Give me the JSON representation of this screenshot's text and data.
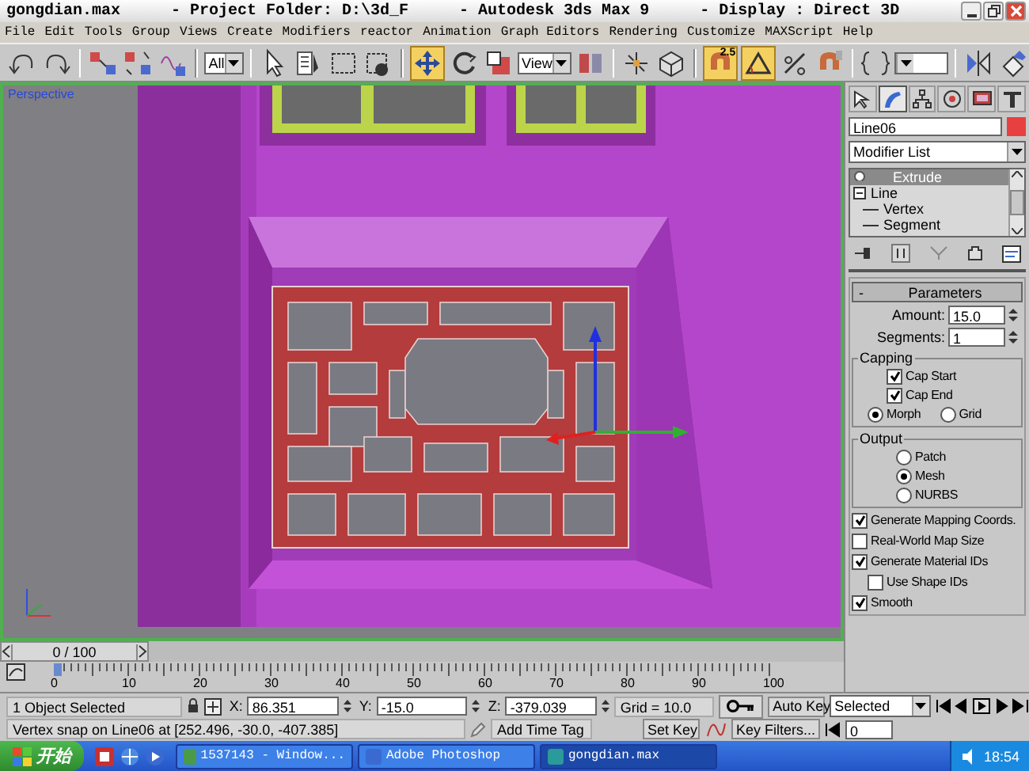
{
  "window": {
    "title_parts": [
      "gongdian.max",
      "- Project Folder: D:\\3d_F",
      "- Autodesk 3ds Max 9",
      "- Display : Direct 3D"
    ]
  },
  "menu": [
    "File",
    "Edit",
    "Tools",
    "Group",
    "Views",
    "Create",
    "Modifiers",
    "reactor",
    "Animation",
    "Graph Editors",
    "Rendering",
    "Customize",
    "MAXScript",
    "Help"
  ],
  "toolbar": [
    {
      "kind": "tool",
      "selected": false
    },
    {
      "kind": "tool",
      "selected": false
    },
    {
      "kind": "separator"
    },
    {
      "kind": "tool",
      "selected": false
    },
    {
      "kind": "tool",
      "selected": false
    },
    {
      "kind": "tool",
      "selected": false
    },
    {
      "kind": "separator"
    },
    {
      "kind": "dropdown",
      "value": "All"
    },
    {
      "kind": "separator"
    },
    {
      "kind": "tool",
      "selected": false
    },
    {
      "kind": "tool",
      "selected": false
    },
    {
      "kind": "tool",
      "selected": false
    },
    {
      "kind": "tool",
      "selected": false
    },
    {
      "kind": "separator"
    },
    {
      "kind": "tool",
      "selected": true
    },
    {
      "kind": "tool",
      "selected": false
    },
    {
      "kind": "tool",
      "selected": false
    },
    {
      "kind": "dropdown",
      "value": "View"
    },
    {
      "kind": "tool",
      "selected": false
    },
    {
      "kind": "separator"
    },
    {
      "kind": "tool",
      "selected": false
    },
    {
      "kind": "tool",
      "selected": false
    },
    {
      "kind": "separator"
    },
    {
      "kind": "tool",
      "selected": true,
      "label": "2.5"
    },
    {
      "kind": "tool",
      "selected": true
    },
    {
      "kind": "tool",
      "selected": false
    },
    {
      "kind": "tool",
      "selected": false
    },
    {
      "kind": "separator"
    },
    {
      "kind": "tool",
      "selected": false
    },
    {
      "kind": "dropdown"
    },
    {
      "kind": "separator"
    },
    {
      "kind": "tool",
      "selected": false
    },
    {
      "kind": "tool",
      "selected": false
    }
  ],
  "viewport": {
    "label": "Perspective"
  },
  "time_slider": {
    "label": "0 / 100"
  },
  "ruler": {
    "labels": [
      "0",
      "10",
      "20",
      "30",
      "40",
      "50",
      "60",
      "70",
      "80",
      "90",
      "100"
    ]
  },
  "command_panel": {
    "tabs": [
      {
        "selected": false
      },
      {
        "selected": true
      },
      {
        "selected": false
      },
      {
        "selected": false
      },
      {
        "selected": false
      },
      {
        "selected": false
      }
    ],
    "object_name": "Line06",
    "modifier_list": "Modifier List",
    "stack": [
      {
        "label": "Extrude",
        "selected": true
      },
      {
        "label": "Line",
        "selected": false,
        "expanded": true,
        "children": [
          {
            "label": "Vertex",
            "selected": false
          },
          {
            "label": "Segment",
            "selected": false
          }
        ]
      }
    ],
    "parameters": {
      "title": "Parameters",
      "collapse_symbol": "-",
      "amount": {
        "label": "Amount:",
        "value": "15.0"
      },
      "segments": {
        "label": "Segments:",
        "value": "1"
      },
      "groups": [
        {
          "title": "Capping",
          "checks": [
            {
              "label": "Cap Start",
              "checked": true
            },
            {
              "label": "Cap End",
              "checked": true
            }
          ],
          "radios": [
            {
              "label": "Morph",
              "selected": true
            },
            {
              "label": "Grid",
              "selected": false
            }
          ]
        },
        {
          "title": "Output",
          "radios": [
            {
              "label": "Patch",
              "selected": false
            },
            {
              "label": "Mesh",
              "selected": true
            },
            {
              "label": "NURBS",
              "selected": false
            }
          ]
        }
      ],
      "options": [
        {
          "label": "Generate Mapping Coords.",
          "checked": true
        },
        {
          "label": "Real-World Map Size",
          "checked": false
        },
        {
          "label": "Generate Material IDs",
          "checked": true,
          "children": [
            {
              "label": "Use Shape IDs",
              "checked": false
            }
          ]
        },
        {
          "label": "Smooth",
          "checked": true
        }
      ]
    }
  },
  "status": {
    "selection": "1 Object Selected",
    "x": {
      "label": "X:",
      "value": "86.351"
    },
    "y": {
      "label": "Y:",
      "value": "-15.0"
    },
    "z": {
      "label": "Z:",
      "value": "-379.039"
    },
    "grid": "Grid = 10.0",
    "prompt": "Vertex snap on Line06 at [252.496, -30.0, -407.385]",
    "time_tag": "Add Time Tag",
    "auto_key": "Auto Key",
    "set_key": "Set Key",
    "key_mode": "Selected",
    "key_filters": "Key Filters...",
    "frame": "0"
  },
  "taskbar": {
    "start": "开始",
    "tasks": [
      {
        "label": "1537143 - Window...",
        "selected": false
      },
      {
        "label": "Adobe Photoshop",
        "selected": false
      },
      {
        "label": "gongdian.max",
        "selected": true
      }
    ],
    "clock": "18:54"
  }
}
